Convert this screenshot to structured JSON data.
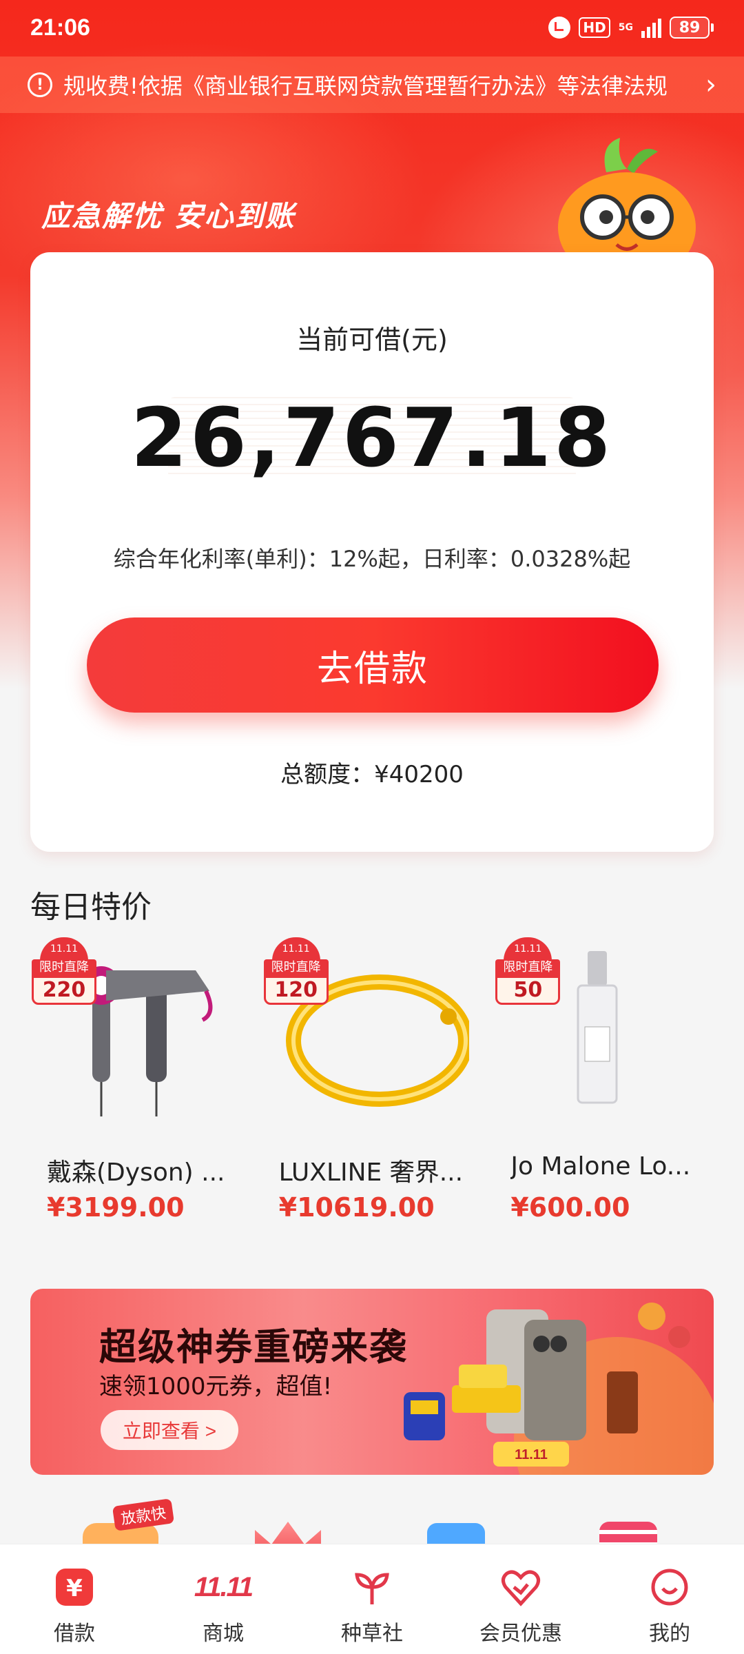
{
  "status_bar": {
    "time": "21:06",
    "network": "5G",
    "hd": "HD",
    "battery": "89"
  },
  "notice": {
    "text": "规收费!依据《商业银行互联网贷款管理暂行办法》等法律法规"
  },
  "hero": {
    "slogan": "应急解忧 安心到账"
  },
  "loan_card": {
    "label": "当前可借(元)",
    "amount": "26,767.18",
    "rate_text": "综合年化利率(单利)：12%起，日利率：0.0328%起",
    "button_label": "去借款",
    "total_text": "总额度：¥40200"
  },
  "daily_deals": {
    "title": "每日特价",
    "badge_top": "11.11",
    "badge_label": "限时直降",
    "items": [
      {
        "name": "戴森(Dyson) ...",
        "price": "¥3199.00",
        "discount": "220",
        "icon": "hair-dryer-icon"
      },
      {
        "name": "LUXLINE 奢界...",
        "price": "¥10619.00",
        "discount": "120",
        "icon": "gold-bracelet-icon"
      },
      {
        "name": "Jo Malone Lo...",
        "price": "¥600.00",
        "discount": "50",
        "icon": "perfume-icon"
      }
    ]
  },
  "promo": {
    "title": "超级神券重磅来袭",
    "subtitle": "速领1000元券，超值!",
    "button_label": "立即查看 >",
    "tag": "11.11",
    "floating_badge": "放款快"
  },
  "bottom_nav": {
    "items": [
      {
        "label": "借款",
        "icon": "yuan-icon",
        "active": true
      },
      {
        "label": "商城",
        "icon": "mall-1111-icon",
        "icon_text": "11.11"
      },
      {
        "label": "种草社",
        "icon": "sprout-icon"
      },
      {
        "label": "会员优惠",
        "icon": "heart-vip-icon"
      },
      {
        "label": "我的",
        "icon": "profile-smile-icon"
      }
    ]
  },
  "colors": {
    "brand_red": "#f43a2c",
    "price_red": "#e83a2e"
  }
}
